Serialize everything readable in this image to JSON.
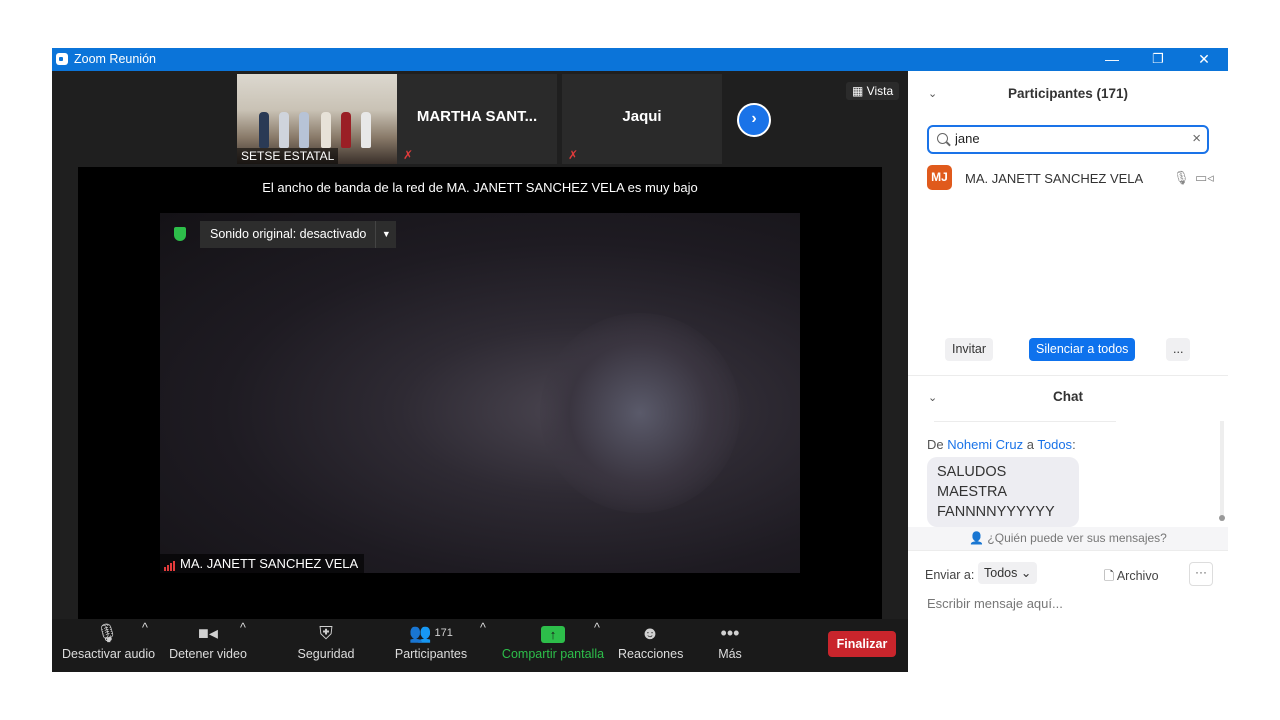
{
  "window": {
    "title": "Zoom Reunión",
    "minimize": "—",
    "restore": "❐",
    "close": "✕"
  },
  "stage": {
    "thumbnails": [
      {
        "name": "SETSE ESTATAL"
      },
      {
        "name": "MARTHA SANT..."
      },
      {
        "name": "Jaqui"
      }
    ],
    "next_label": "›",
    "view_label": "Vista",
    "bandwidth_message": "El ancho de banda de la red de MA. JANETT SANCHEZ VELA es muy bajo",
    "original_sound": "Sonido original: desactivado",
    "speaker_name": "MA. JANETT SANCHEZ VELA"
  },
  "toolbar": {
    "audio": "Desactivar audio",
    "video": "Detener video",
    "security": "Seguridad",
    "participants": "Participantes",
    "participants_count": "171",
    "share": "Compartir pantalla",
    "reactions": "Reacciones",
    "more": "Más",
    "end": "Finalizar"
  },
  "colors": {
    "accent": "#1a73e8",
    "end": "#c9252c",
    "share": "#2dbe4a",
    "titlebar": "#0b74d9"
  },
  "participants_panel": {
    "title": "Participantes (171)",
    "search_value": "jane",
    "participant": {
      "initials": "MJ",
      "name": "MA. JANETT SANCHEZ VELA"
    },
    "invite": "Invitar",
    "mute_all": "Silenciar a todos",
    "more": "..."
  },
  "chat": {
    "title": "Chat",
    "from_prefix": "De",
    "sender": "Nohemi Cruz",
    "to_word": "a",
    "recipient": "Todos",
    "message": "SALUDOS MAESTRA FANNNNYYYYYY",
    "who_can_see": "¿Quién puede ver sus mensajes?",
    "send_to_label": "Enviar a:",
    "send_to_value": "Todos",
    "file_label": "Archivo",
    "more": "···",
    "input_placeholder": "Escribir mensaje aquí..."
  }
}
